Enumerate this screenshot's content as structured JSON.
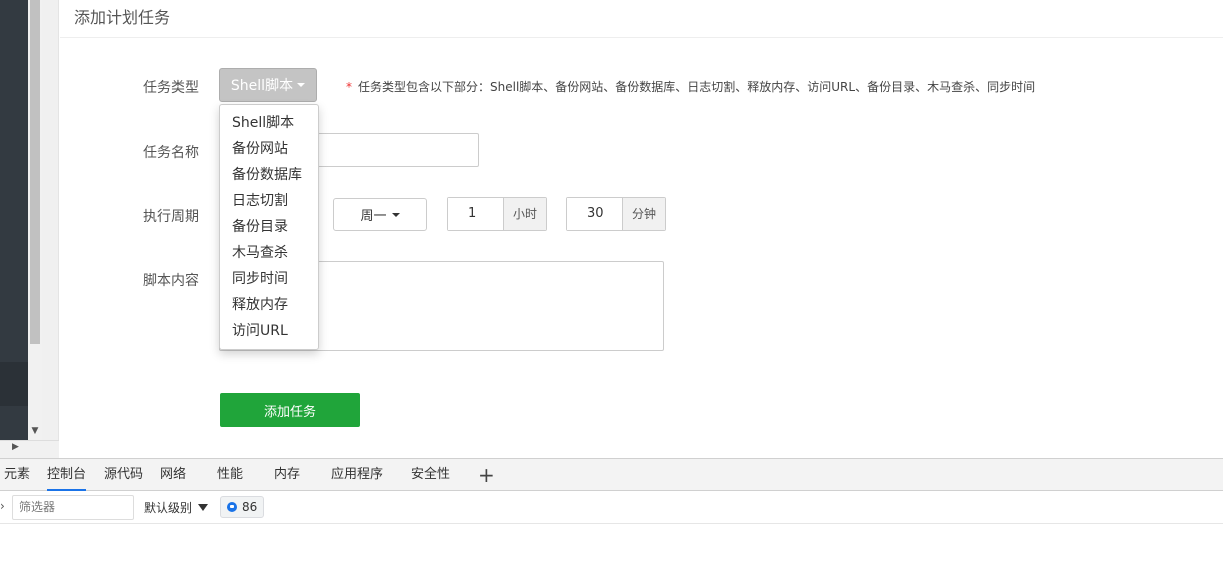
{
  "panel": {
    "title": "添加计划任务"
  },
  "form": {
    "task_type": {
      "label": "任务类型",
      "selected": "Shell脚本",
      "hint_star": "*",
      "hint": "任务类型包含以下部分：Shell脚本、备份网站、备份数据库、日志切割、释放内存、访问URL、备份目录、木马查杀、同步时间",
      "options": [
        "Shell脚本",
        "备份网站",
        "备份数据库",
        "日志切割",
        "备份目录",
        "木马查杀",
        "同步时间",
        "释放内存",
        "访问URL"
      ]
    },
    "task_name": {
      "label": "任务名称",
      "value": ""
    },
    "period": {
      "label": "执行周期",
      "weekday": "周一",
      "hour_value": "1",
      "hour_unit": "小时",
      "minute_value": "30",
      "minute_unit": "分钟"
    },
    "script": {
      "label": "脚本内容",
      "value": ""
    },
    "submit_label": "添加任务"
  },
  "devtools": {
    "tabs": [
      "元素",
      "控制台",
      "源代码",
      "网络",
      "性能",
      "内存",
      "应用程序",
      "安全性"
    ],
    "active_tab": "控制台",
    "plus": "+",
    "filter_placeholder": "筛选器",
    "level_label": "默认级别",
    "message_count": "86"
  },
  "colors": {
    "primary_button": "#20a53a",
    "sidebar": "#333a41",
    "active_tab_underline": "#1a73e8"
  }
}
